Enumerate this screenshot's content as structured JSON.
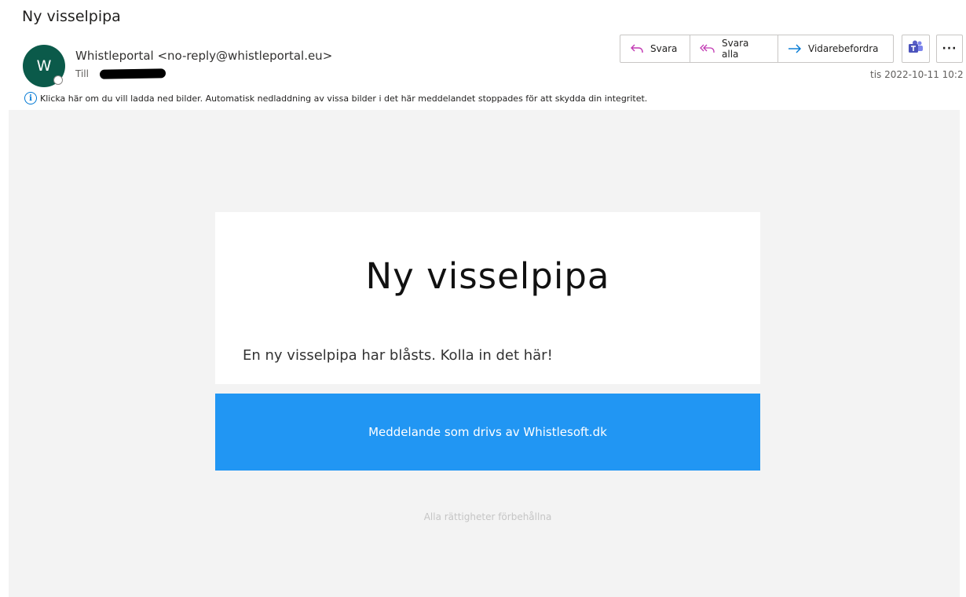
{
  "email": {
    "subject": "Ny visselpipa",
    "avatar_initial": "W",
    "sender": "Whistleportal <no-reply@whistleportal.eu>",
    "to_label": "Till",
    "date": "tis 2022-10-11 10:2",
    "info_text": "Klicka här om du vill ladda ned bilder. Automatisk nedladdning av vissa bilder i det här meddelandet stoppades för att skydda din integritet."
  },
  "toolbar": {
    "reply": "Svara",
    "reply_all": "Svara alla",
    "forward": "Vidarebefordra",
    "more": "···"
  },
  "message": {
    "title": "Ny visselpipa",
    "text": "En ny visselpipa har blåsts. Kolla in det här!",
    "banner": "Meddelande som drivs av Whistlesoft.dk",
    "rights": "Alla rättigheter förbehållna"
  },
  "colors": {
    "avatar": "#0b5a4a",
    "banner": "#2196f3",
    "reply_icon": "#c239b3",
    "forward_icon": "#0078d4",
    "teams": "#5b5fc7"
  }
}
